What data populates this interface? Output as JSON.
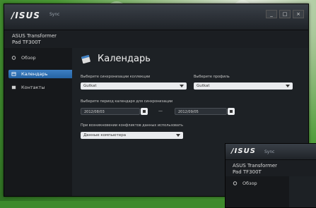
{
  "app": {
    "logo": "/ISUS",
    "sync_label": "Sync",
    "device_name_line1": "ASUS Transformer",
    "device_name_line2": "Pad TF300T"
  },
  "window_controls": [
    "_",
    "□",
    "×"
  ],
  "sidebar": {
    "items": [
      {
        "label": "Обзор",
        "icon": "overview-icon"
      },
      {
        "label": "Календарь",
        "icon": "calendar-icon",
        "selected": true
      },
      {
        "label": "Контакты",
        "icon": "contacts-icon"
      }
    ]
  },
  "main": {
    "title": "Календарь",
    "title_icon": "calendar-icon",
    "collection_label": "Выберите синхронизации коллекции",
    "collection_value": "Gutkat",
    "profile_label": "Выберите профиль",
    "profile_value": "Gutkat",
    "period_label": "Выберите период календаря для синхронизации",
    "date_from": "2012/08/03",
    "date_to": "2012/09/05",
    "dash": "—",
    "conflict_label": "При возникновении конфликтов данных использовать",
    "conflict_value": "Данные компьютера"
  },
  "colors": {
    "accent": "#2563a3",
    "window_bg": "#1b1e22",
    "desktop": "#3e8a2c"
  }
}
